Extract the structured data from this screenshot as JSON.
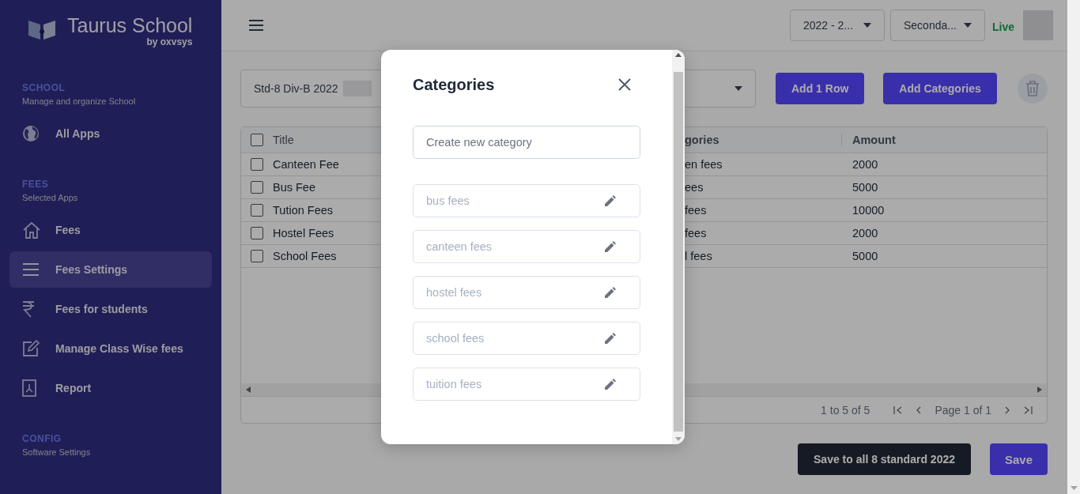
{
  "sidebar": {
    "brand": {
      "name": "Taurus School",
      "byline": "by oxvsys"
    },
    "sections": [
      {
        "title": "SCHOOL",
        "subtitle": "Manage and organize School",
        "items": [
          {
            "label": "All Apps",
            "selected": false
          }
        ]
      },
      {
        "title": "FEES",
        "subtitle": "Selected Apps",
        "items": [
          {
            "label": "Fees",
            "selected": false
          },
          {
            "label": "Fees Settings",
            "selected": true
          },
          {
            "label": "Fees for students",
            "selected": false
          },
          {
            "label": "Manage Class Wise fees",
            "selected": false
          },
          {
            "label": "Report",
            "selected": false
          }
        ]
      },
      {
        "title": "CONFIG",
        "subtitle": "Software Settings"
      }
    ]
  },
  "header": {
    "year_select": "2022 - 2...",
    "level_select": "Seconda...",
    "status": "Live"
  },
  "toolbar": {
    "class_select": "Std-8 Div-B 2022",
    "buttons": [
      "Add 1 Row",
      "Add Categories"
    ]
  },
  "table": {
    "columns": [
      "Title",
      "gories",
      "Amount"
    ],
    "all_checked": false,
    "rows": [
      {
        "checked": false,
        "title": "Canteen Fee",
        "category": "en fees",
        "amount": "2000"
      },
      {
        "checked": false,
        "title": "Bus Fee",
        "category": "ees",
        "amount": "5000"
      },
      {
        "checked": false,
        "title": "Tution Fees",
        "category": "fees",
        "amount": "10000"
      },
      {
        "checked": false,
        "title": "Hostel Fees",
        "category": "fees",
        "amount": "2000"
      },
      {
        "checked": false,
        "title": "School Fees",
        "category": "l fees",
        "amount": "5000"
      }
    ],
    "range": "1 to 5 of 5",
    "page": "Page 1 of 1"
  },
  "actions": [
    "Save to all 8 standard 2022",
    "Save"
  ],
  "dialog": {
    "title": "Categories",
    "placeholder": "Create new category",
    "categories": [
      "bus fees",
      "canteen fees",
      "hostel fees",
      "school fees",
      "tuition fees"
    ]
  }
}
